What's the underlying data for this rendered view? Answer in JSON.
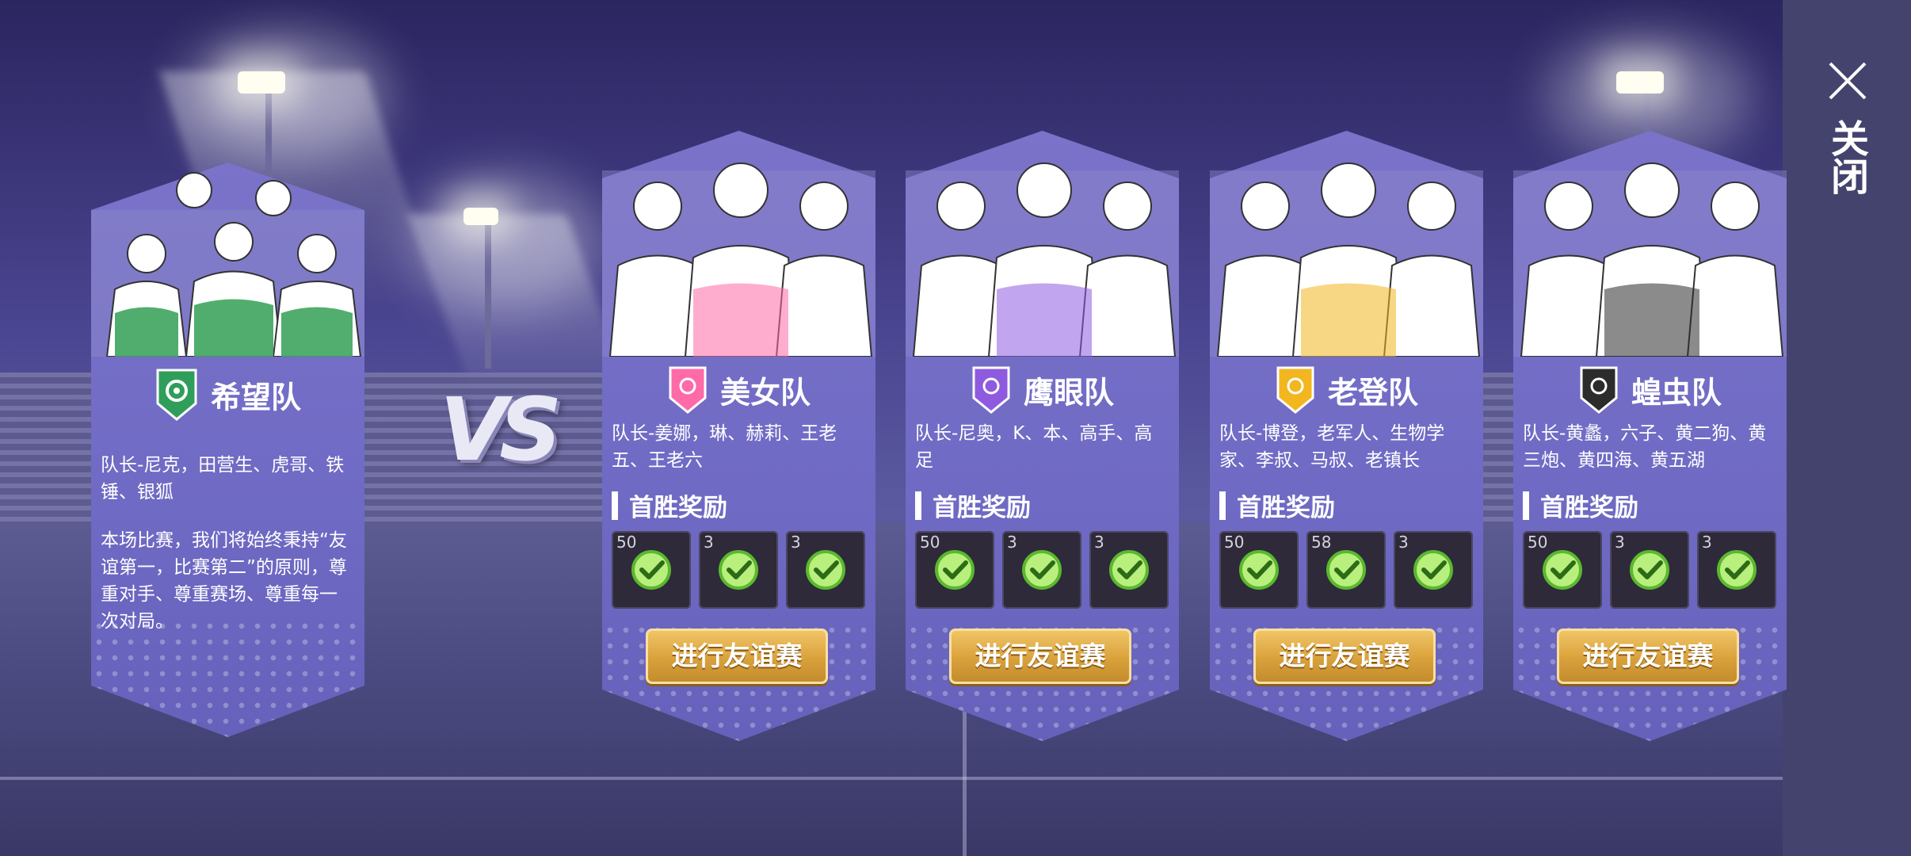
{
  "close": {
    "label": "关闭"
  },
  "vs": {
    "label": "VS"
  },
  "home_team": {
    "name": "希望队",
    "members": "队长-尼克，田营生、虎哥、铁锤、银狐",
    "description": "本场比赛，我们将始终秉持“友谊第一，比赛第二”的原则，尊重对手、尊重赛场、尊重每一次对局。",
    "color": "#2f9e5a"
  },
  "reward_title": "首胜奖励",
  "play_button_label": "进行友谊赛",
  "teams": [
    {
      "name": "美女队",
      "members": "队长-姜娜，琳、赫莉、王老五、王老六",
      "badge_color": "#ff6aa8",
      "rewards": [
        "50",
        "3",
        "3"
      ]
    },
    {
      "name": "鹰眼队",
      "members": "队长-尼奥，K、本、高手、高足",
      "badge_color": "#8e5be0",
      "rewards": [
        "50",
        "3",
        "3"
      ]
    },
    {
      "name": "老登队",
      "members": "队长-博登，老军人、生物学家、李叔、马叔、老镇长",
      "badge_color": "#f2b61f",
      "rewards": [
        "50",
        "58",
        "3"
      ]
    },
    {
      "name": "蝗虫队",
      "members": "队长-黄蠡，六子、黄二狗、黄三炮、黄四海、黄五湖",
      "badge_color": "#2c2c2c",
      "rewards": [
        "50",
        "3",
        "3"
      ]
    }
  ],
  "icons": {
    "reward_check": "check-circle-icon",
    "close": "close-x-icon"
  }
}
